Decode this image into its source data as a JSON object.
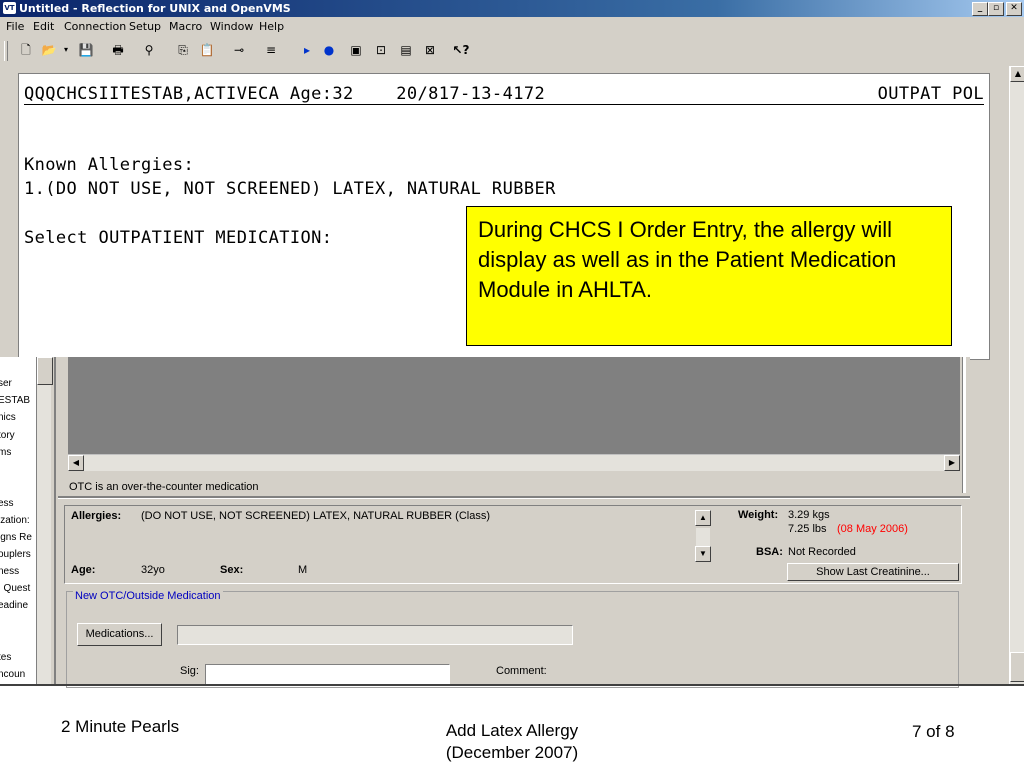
{
  "window": {
    "title": "Untitled - Reflection for UNIX and OpenVMS",
    "app_icon": "VT"
  },
  "menu": [
    "File",
    "Edit",
    "Connection",
    "Setup",
    "Macro",
    "Window",
    "Help"
  ],
  "toolbar_icons": [
    "new-file-icon",
    "open-folder-icon",
    "save-icon",
    "print-icon",
    "find-icon",
    "copy-icon",
    "paste-icon",
    "connect-icon",
    "script-icon",
    "play-icon",
    "record-icon",
    "settings-icon",
    "display-icon",
    "keyboard-icon",
    "mouse-icon",
    "context-help-icon"
  ],
  "terminal": {
    "header_left": "QQQCHCSIITESTAB,ACTIVECA Age:32    20/817-13-4172",
    "header_right": "OUTPAT POL",
    "known_allergies_label": "Known Allergies:",
    "allergy_line": "1.(DO NOT USE, NOT SCREENED) LATEX, NATURAL RUBBER",
    "prompt": "Select OUTPATIENT MEDICATION:"
  },
  "callout": {
    "text": "During CHCS I Order Entry, the allergy will display as well as in the Patient Medication Module in AHLTA."
  },
  "ahlta": {
    "left_strip_items": [
      "ser",
      "ESTAB",
      "nics",
      "tory",
      "ms",
      "ess",
      "ization:",
      "igns Re",
      "ouplers",
      "ness",
      ": Quest",
      "eadine",
      "tes",
      "ncoun"
    ],
    "otc_note": "OTC is an over-the-counter medication",
    "allergies_label": "Allergies:",
    "allergies_value": "(DO NOT USE, NOT SCREENED) LATEX, NATURAL RUBBER (Class)",
    "weight_label": "Weight:",
    "weight_kg": "3.29 kgs",
    "weight_lbs": "7.25 lbs",
    "weight_date": "(08 May 2006)",
    "bsa_label": "BSA:",
    "bsa_value": "Not Recorded",
    "show_creatinine_button": "Show Last Creatinine...",
    "age_label": "Age:",
    "age_value": "32yo",
    "sex_label": "Sex:",
    "sex_value": "M",
    "new_otc_group_label": "New OTC/Outside Medication",
    "medications_button": "Medications...",
    "sig_label": "Sig:",
    "comment_label": "Comment:"
  },
  "footer": {
    "left": "2 Minute Pearls",
    "center_line1": "Add Latex Allergy",
    "center_line2": "(December 2007)",
    "right": "7 of 8"
  },
  "colors": {
    "titlebar": "#0a246a",
    "callout_bg": "#ffff00",
    "date_red": "#ff0000",
    "group_label_blue": "#0000c0"
  }
}
